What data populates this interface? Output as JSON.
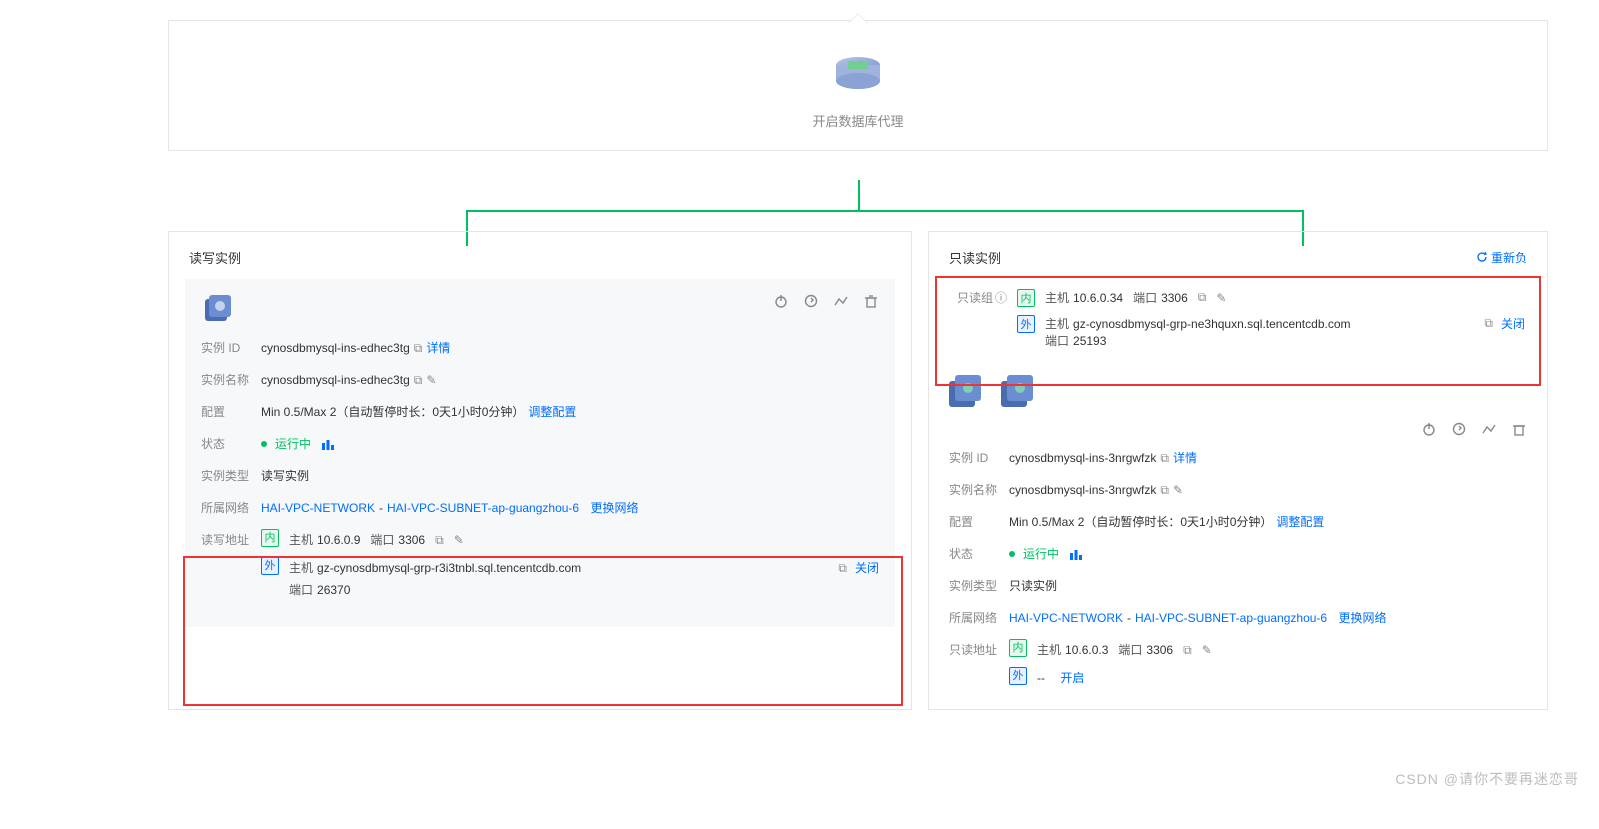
{
  "proxy": {
    "label": "开启数据库代理"
  },
  "rw_panel": {
    "title": "读写实例",
    "instance_id_label": "实例 ID",
    "instance_id": "cynosdbmysql-ins-edhec3tg",
    "details": "详情",
    "instance_name_label": "实例名称",
    "instance_name": "cynosdbmysql-ins-edhec3tg",
    "config_label": "配置",
    "config_value": "Min 0.5/Max 2（自动暂停时长：0天1小时0分钟）",
    "adjust_config": "调整配置",
    "status_label": "状态",
    "status_value": "运行中",
    "instance_type_label": "实例类型",
    "instance_type_value": "读写实例",
    "network_label": "所属网络",
    "network_vpc": "HAI-VPC-NETWORK",
    "network_subnet": "HAI-VPC-SUBNET-ap-guangzhou-6",
    "change_network": "更换网络",
    "rw_addr_label": "读写地址",
    "inner_tag": "内",
    "outer_tag": "外",
    "host_lbl": "主机",
    "port_lbl": "端口",
    "inner_host": "10.6.0.9",
    "inner_port": "3306",
    "outer_host": "gz-cynosdbmysql-grp-r3i3tnbl.sql.tencentcdb.com",
    "outer_port": "26370",
    "close": "关闭"
  },
  "ro_panel": {
    "title": "只读实例",
    "redo": "重新负",
    "group_label": "只读组",
    "inner_tag": "内",
    "outer_tag": "外",
    "host_lbl": "主机",
    "port_lbl": "端口",
    "inner_host": "10.6.0.34",
    "inner_port": "3306",
    "outer_host": "gz-cynosdbmysql-grp-ne3hquxn.sql.tencentcdb.com",
    "outer_port": "25193",
    "close": "关闭",
    "instance_id_label": "实例 ID",
    "instance_id": "cynosdbmysql-ins-3nrgwfzk",
    "details": "详情",
    "instance_name_label": "实例名称",
    "instance_name": "cynosdbmysql-ins-3nrgwfzk",
    "config_label": "配置",
    "config_value": "Min 0.5/Max 2（自动暂停时长：0天1小时0分钟）",
    "adjust_config": "调整配置",
    "status_label": "状态",
    "status_value": "运行中",
    "instance_type_label": "实例类型",
    "instance_type_value": "只读实例",
    "network_label": "所属网络",
    "network_vpc": "HAI-VPC-NETWORK",
    "network_subnet": "HAI-VPC-SUBNET-ap-guangzhou-6",
    "change_network": "更换网络",
    "ro_addr_label": "只读地址",
    "addr_inner_host": "10.6.0.3",
    "addr_inner_port": "3306",
    "open": "开启",
    "dash": "--"
  },
  "watermark": "CSDN @请你不要再迷恋哥"
}
